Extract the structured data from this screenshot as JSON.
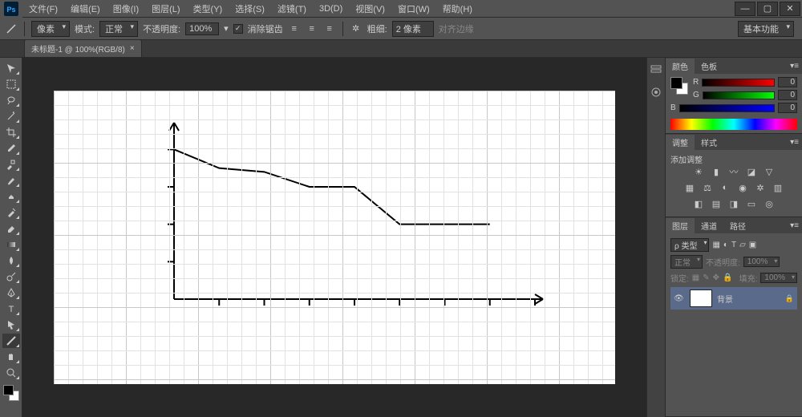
{
  "menu": {
    "file": "文件(F)",
    "edit": "编辑(E)",
    "image": "图像(I)",
    "layer": "图层(L)",
    "type": "类型(Y)",
    "select": "选择(S)",
    "filter": "滤镜(T)",
    "three_d": "3D(D)",
    "view": "视图(V)",
    "window": "窗口(W)",
    "help": "帮助(H)"
  },
  "options": {
    "unit": "像素",
    "mode_label": "模式:",
    "mode_value": "正常",
    "opacity_label": "不透明度:",
    "opacity_value": "100%",
    "antialias": "消除锯齿",
    "weight_label": "粗细:",
    "weight_value": "2 像素",
    "align_label": "对齐边缘",
    "workspace": "基本功能"
  },
  "tab": {
    "title": "未标题-1 @ 100%(RGB/8)"
  },
  "panels": {
    "color": {
      "tab_color": "颜色",
      "tab_swatches": "色板",
      "r": "R",
      "g": "G",
      "b": "B",
      "r_val": "0",
      "g_val": "0",
      "b_val": "0"
    },
    "adjust": {
      "tab_adjust": "调整",
      "tab_styles": "样式",
      "add_adjust": "添加调整"
    },
    "layers": {
      "tab_layers": "图层",
      "tab_channels": "通道",
      "tab_paths": "路径",
      "kind_label": "ρ 类型",
      "blend_mode": "正常",
      "opacity_label": "不透明度:",
      "opacity_value": "100%",
      "lock_label": "锁定:",
      "fill_label": "填充:",
      "fill_value": "100%",
      "layer_name": "背景"
    }
  },
  "chart_data": {
    "type": "line",
    "x": [
      0,
      1,
      2,
      3,
      4,
      5,
      6,
      7
    ],
    "values": [
      4,
      3.5,
      3.4,
      3,
      3,
      2,
      2,
      2
    ],
    "xlim": [
      0,
      8
    ],
    "ylim": [
      0,
      4.5
    ],
    "xlabel": "",
    "ylabel": "",
    "title": ""
  }
}
